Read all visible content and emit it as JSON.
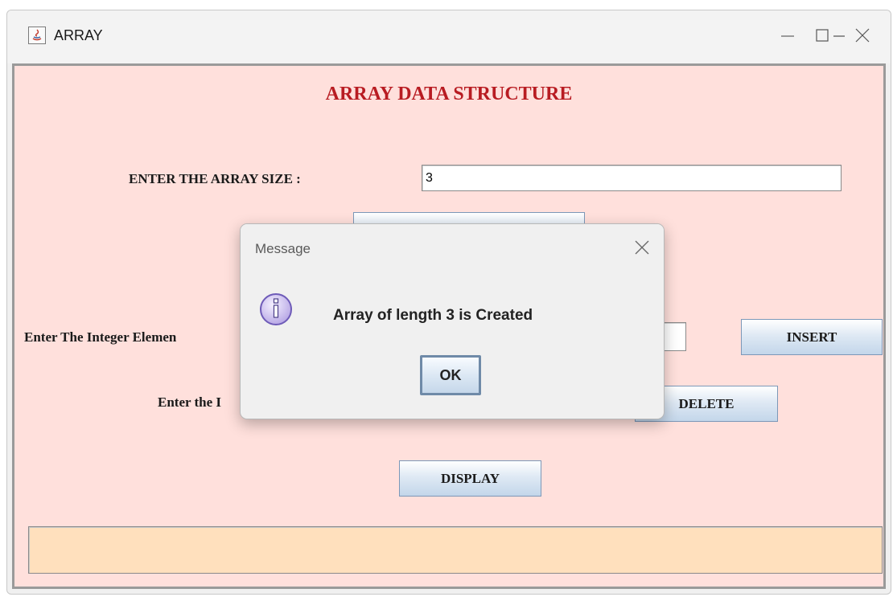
{
  "window": {
    "title": "ARRAY"
  },
  "main": {
    "heading": "ARRAY DATA STRUCTURE",
    "array_size_label": "ENTER THE ARRAY SIZE :",
    "array_size_value": "3",
    "create_button_label": "",
    "insert_label": "Enter The Integer Elemen",
    "insert_value": "",
    "insert_button_label": "INSERT",
    "delete_label": "Enter the I",
    "delete_button_label": "DELETE",
    "display_button_label": "DISPLAY",
    "output_value": ""
  },
  "dialog": {
    "title": "Message",
    "message": "Array of length 3 is Created",
    "ok_label": "OK"
  },
  "colors": {
    "panel_background": "#ffe0dc",
    "heading_color": "#b81c22",
    "output_background": "#ffe0bd"
  }
}
